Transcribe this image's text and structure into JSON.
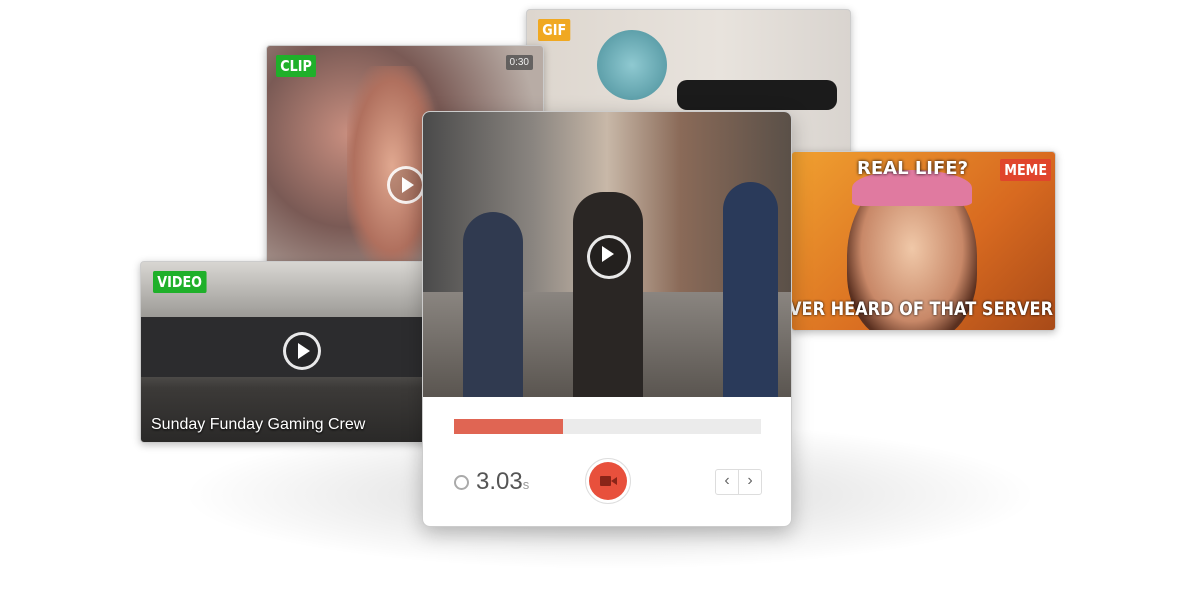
{
  "cards": {
    "gif": {
      "badge": "GIF",
      "badge_color": "#f0a821"
    },
    "clip": {
      "badge": "CLIP",
      "badge_color": "#1fb02a",
      "duration": "0:30"
    },
    "video": {
      "badge": "VIDEO",
      "badge_color": "#1fb02a",
      "caption": "Sunday Funday Gaming Crew"
    },
    "meme": {
      "badge": "MEME",
      "badge_color": "#e0452c",
      "top_text": "REAL LIFE?",
      "bottom_text": "EVER HEARD OF THAT SERVER"
    }
  },
  "recorder": {
    "progress_percent": 35.5,
    "progress_color": "#e06553",
    "time_value": "3.03",
    "time_unit": "s",
    "icons": [
      "clock-icon",
      "video-camera-icon",
      "chevron-left-icon",
      "chevron-right-icon"
    ]
  }
}
